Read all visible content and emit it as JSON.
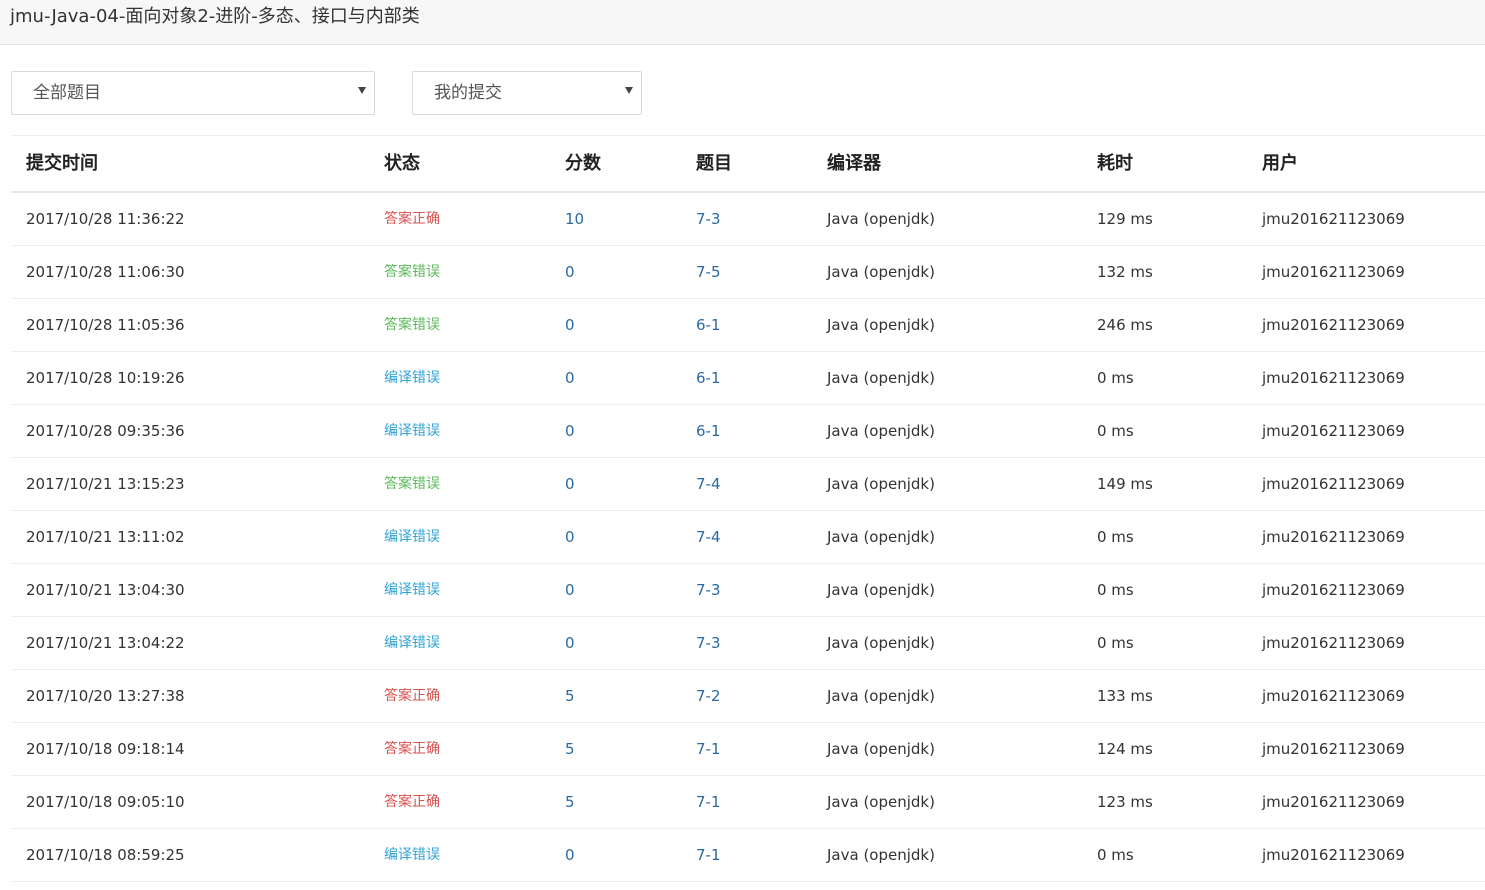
{
  "header": {
    "title": "jmu-Java-04-面向对象2-进阶-多态、接口与内部类"
  },
  "filters": {
    "problem_select": {
      "value": "全部题目"
    },
    "submission_select": {
      "value": "我的提交"
    }
  },
  "colors": {
    "accepted": "#d9534f",
    "wrong_answer": "#5cb85c",
    "compile_error": "#31a3d6",
    "link": "#2b6aa0"
  },
  "table": {
    "headers": [
      "提交时间",
      "状态",
      "分数",
      "题目",
      "编译器",
      "耗时",
      "用户"
    ],
    "rows": [
      {
        "time": "2017/10/28 11:36:22",
        "status": "答案正确",
        "status_type": "accepted",
        "score": "10",
        "problem": "7-3",
        "compiler": "Java (openjdk)",
        "elapsed": "129 ms",
        "user": "jmu201621123069"
      },
      {
        "time": "2017/10/28 11:06:30",
        "status": "答案错误",
        "status_type": "wrong_answer",
        "score": "0",
        "problem": "7-5",
        "compiler": "Java (openjdk)",
        "elapsed": "132 ms",
        "user": "jmu201621123069"
      },
      {
        "time": "2017/10/28 11:05:36",
        "status": "答案错误",
        "status_type": "wrong_answer",
        "score": "0",
        "problem": "6-1",
        "compiler": "Java (openjdk)",
        "elapsed": "246 ms",
        "user": "jmu201621123069"
      },
      {
        "time": "2017/10/28 10:19:26",
        "status": "编译错误",
        "status_type": "compile_error",
        "score": "0",
        "problem": "6-1",
        "compiler": "Java (openjdk)",
        "elapsed": "0 ms",
        "user": "jmu201621123069"
      },
      {
        "time": "2017/10/28 09:35:36",
        "status": "编译错误",
        "status_type": "compile_error",
        "score": "0",
        "problem": "6-1",
        "compiler": "Java (openjdk)",
        "elapsed": "0 ms",
        "user": "jmu201621123069"
      },
      {
        "time": "2017/10/21 13:15:23",
        "status": "答案错误",
        "status_type": "wrong_answer",
        "score": "0",
        "problem": "7-4",
        "compiler": "Java (openjdk)",
        "elapsed": "149 ms",
        "user": "jmu201621123069"
      },
      {
        "time": "2017/10/21 13:11:02",
        "status": "编译错误",
        "status_type": "compile_error",
        "score": "0",
        "problem": "7-4",
        "compiler": "Java (openjdk)",
        "elapsed": "0 ms",
        "user": "jmu201621123069"
      },
      {
        "time": "2017/10/21 13:04:30",
        "status": "编译错误",
        "status_type": "compile_error",
        "score": "0",
        "problem": "7-3",
        "compiler": "Java (openjdk)",
        "elapsed": "0 ms",
        "user": "jmu201621123069"
      },
      {
        "time": "2017/10/21 13:04:22",
        "status": "编译错误",
        "status_type": "compile_error",
        "score": "0",
        "problem": "7-3",
        "compiler": "Java (openjdk)",
        "elapsed": "0 ms",
        "user": "jmu201621123069"
      },
      {
        "time": "2017/10/20 13:27:38",
        "status": "答案正确",
        "status_type": "accepted",
        "score": "5",
        "problem": "7-2",
        "compiler": "Java (openjdk)",
        "elapsed": "133 ms",
        "user": "jmu201621123069"
      },
      {
        "time": "2017/10/18 09:18:14",
        "status": "答案正确",
        "status_type": "accepted",
        "score": "5",
        "problem": "7-1",
        "compiler": "Java (openjdk)",
        "elapsed": "124 ms",
        "user": "jmu201621123069"
      },
      {
        "time": "2017/10/18 09:05:10",
        "status": "答案正确",
        "status_type": "accepted",
        "score": "5",
        "problem": "7-1",
        "compiler": "Java (openjdk)",
        "elapsed": "123 ms",
        "user": "jmu201621123069"
      },
      {
        "time": "2017/10/18 08:59:25",
        "status": "编译错误",
        "status_type": "compile_error",
        "score": "0",
        "problem": "7-1",
        "compiler": "Java (openjdk)",
        "elapsed": "0 ms",
        "user": "jmu201621123069"
      }
    ]
  }
}
